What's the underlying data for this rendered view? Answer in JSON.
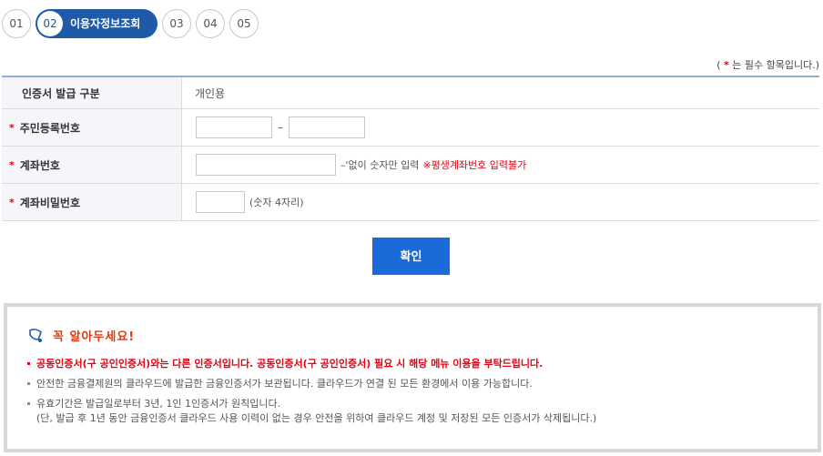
{
  "steps": {
    "s1": "01",
    "s2": "02",
    "s2_label": "이용자정보조회",
    "s3": "03",
    "s4": "04",
    "s5": "05"
  },
  "required_note": {
    "open": "(",
    "star": "*",
    "text": "는 필수 항목입니다.)"
  },
  "form": {
    "cert_type": {
      "label": "인증서 발급 구분",
      "value": "개인용"
    },
    "resident": {
      "star": "*",
      "label": "주민등록번호",
      "dash": "–"
    },
    "account": {
      "star": "*",
      "label": "계좌번호",
      "hint": "–'없이 숫자만 입력",
      "warning": "※평생계좌번호 입력불가"
    },
    "password": {
      "star": "*",
      "label": "계좌비밀번호",
      "hint": "(숫자 4자리)"
    }
  },
  "confirm_label": "확인",
  "notice": {
    "title": "꼭 알아두세요!",
    "items": [
      "공동인증서(구 공인인증서)와는 다른 인증서입니다. 공동인증서(구 공인인증서) 필요 시 해당 메뉴 이용을 부탁드립니다.",
      "안전한 금융결제원의 클라우드에 발급한 금융인증서가 보관됩니다. 클라우드가 연결 된 모든 환경에서 이용 가능합니다.",
      "유효기간은 발급일로부터 3년, 1인 1인증서가 원칙입니다."
    ],
    "item3_sub": "(단, 발급 후 1년 동안 금융인증서 클라우드 사용 이력이 없는 경우 안전을 위하여 클라우드 계정 및 저장된 모든 인증서가 삭제됩니다.)"
  },
  "colors": {
    "accent": "#1e5aa8",
    "button": "#1a6ad9",
    "required": "#e60012",
    "notice_title": "#e03a10"
  }
}
